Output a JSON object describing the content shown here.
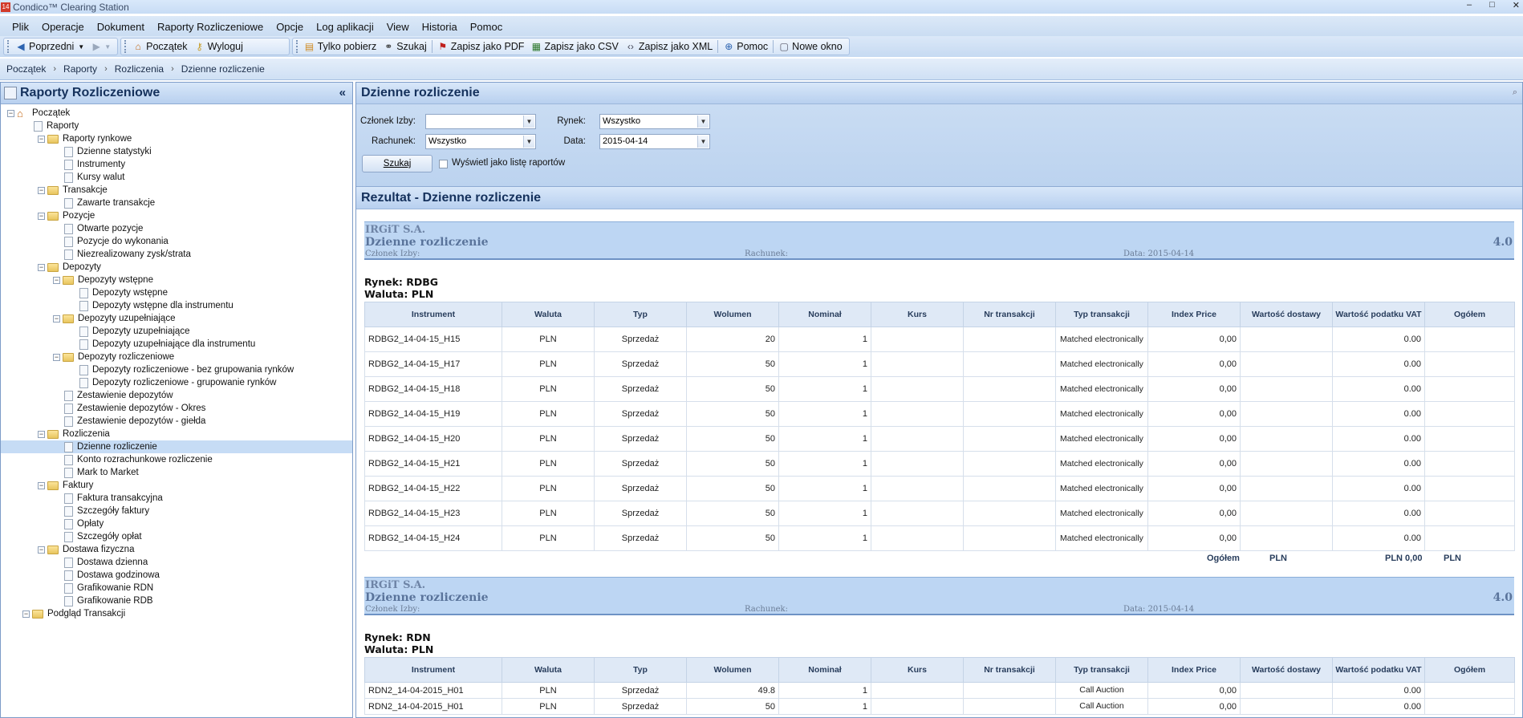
{
  "window": {
    "title": "Condico™ Clearing Station",
    "app_icon": "14",
    "controls": [
      "–",
      "□",
      "✕"
    ]
  },
  "menu": [
    "Plik",
    "Operacje",
    "Dokument",
    "Raporty Rozliczeniowe",
    "Opcje",
    "Log aplikacji",
    "View",
    "Historia",
    "Pomoc"
  ],
  "toolbar": {
    "prev": "Poprzedni",
    "home": "Początek",
    "logout": "Wyloguj",
    "fetch_only": "Tylko pobierz",
    "search": "Szukaj",
    "save_pdf": "Zapisz jako PDF",
    "save_csv": "Zapisz jako CSV",
    "save_xml": "Zapisz jako XML",
    "help": "Pomoc",
    "new_window": "Nowe okno"
  },
  "breadcrumb": [
    "Początek",
    "Raporty",
    "Rozliczenia",
    "Dzienne rozliczenie"
  ],
  "left_panel": {
    "title": "Raporty Rozliczeniowe",
    "collapse": "«",
    "tree": [
      {
        "label": "Początek",
        "level": 0,
        "kind": "home"
      },
      {
        "label": "Raporty",
        "level": 1,
        "kind": "doc"
      },
      {
        "label": "Raporty rynkowe",
        "level": 2,
        "kind": "folder"
      },
      {
        "label": "Dzienne statystyki",
        "level": 3,
        "kind": "doc"
      },
      {
        "label": "Instrumenty",
        "level": 3,
        "kind": "doc"
      },
      {
        "label": "Kursy walut",
        "level": 3,
        "kind": "doc"
      },
      {
        "label": "Transakcje",
        "level": 2,
        "kind": "folder"
      },
      {
        "label": "Zawarte transakcje",
        "level": 3,
        "kind": "doc"
      },
      {
        "label": "Pozycje",
        "level": 2,
        "kind": "folder"
      },
      {
        "label": "Otwarte pozycje",
        "level": 3,
        "kind": "doc"
      },
      {
        "label": "Pozycje do wykonania",
        "level": 3,
        "kind": "doc"
      },
      {
        "label": "Niezrealizowany zysk/strata",
        "level": 3,
        "kind": "doc"
      },
      {
        "label": "Depozyty",
        "level": 2,
        "kind": "folder"
      },
      {
        "label": "Depozyty wstępne",
        "level": 3,
        "kind": "folder"
      },
      {
        "label": "Depozyty wstępne",
        "level": 4,
        "kind": "doc"
      },
      {
        "label": "Depozyty wstępne dla instrumentu",
        "level": 4,
        "kind": "doc"
      },
      {
        "label": "Depozyty uzupełniające",
        "level": 3,
        "kind": "folder"
      },
      {
        "label": "Depozyty uzupełniające",
        "level": 4,
        "kind": "doc"
      },
      {
        "label": "Depozyty uzupełniające dla instrumentu",
        "level": 4,
        "kind": "doc"
      },
      {
        "label": "Depozyty rozliczeniowe",
        "level": 3,
        "kind": "folder"
      },
      {
        "label": "Depozyty rozliczeniowe - bez grupowania rynków",
        "level": 4,
        "kind": "doc"
      },
      {
        "label": "Depozyty rozliczeniowe - grupowanie rynków",
        "level": 4,
        "kind": "doc"
      },
      {
        "label": "Zestawienie depozytów",
        "level": 3,
        "kind": "doc"
      },
      {
        "label": "Zestawienie depozytów - Okres",
        "level": 3,
        "kind": "doc"
      },
      {
        "label": "Zestawienie depozytów - giełda",
        "level": 3,
        "kind": "doc"
      },
      {
        "label": "Rozliczenia",
        "level": 2,
        "kind": "folder"
      },
      {
        "label": "Dzienne rozliczenie",
        "level": 3,
        "kind": "doc",
        "selected": true
      },
      {
        "label": "Konto rozrachunkowe rozliczenie",
        "level": 3,
        "kind": "doc"
      },
      {
        "label": "Mark to Market",
        "level": 3,
        "kind": "doc"
      },
      {
        "label": "Faktury",
        "level": 2,
        "kind": "folder"
      },
      {
        "label": "Faktura transakcyjna",
        "level": 3,
        "kind": "doc"
      },
      {
        "label": "Szczegóły faktury",
        "level": 3,
        "kind": "doc"
      },
      {
        "label": "Opłaty",
        "level": 3,
        "kind": "doc"
      },
      {
        "label": "Szczegóły opłat",
        "level": 3,
        "kind": "doc"
      },
      {
        "label": "Dostawa fizyczna",
        "level": 2,
        "kind": "folder"
      },
      {
        "label": "Dostawa dzienna",
        "level": 3,
        "kind": "doc"
      },
      {
        "label": "Dostawa godzinowa",
        "level": 3,
        "kind": "doc"
      },
      {
        "label": "Grafikowanie RDN",
        "level": 3,
        "kind": "doc"
      },
      {
        "label": "Grafikowanie RDB",
        "level": 3,
        "kind": "doc"
      },
      {
        "label": "Podgląd Transakcji",
        "level": 1,
        "kind": "folder"
      }
    ]
  },
  "form": {
    "title": "Dzienne rozliczenie",
    "member_label": "Członek Izby:",
    "member_value": "",
    "market_label": "Rynek:",
    "market_value": "Wszystko",
    "account_label": "Rachunek:",
    "account_value": "Wszystko",
    "date_label": "Data:",
    "date_value": "2015-04-14",
    "search_button": "Szukaj",
    "list_checkbox": "Wyświetl jako listę raportów"
  },
  "results": {
    "title": "Rezultat - Dzienne rozliczenie",
    "columns": [
      "Instrument",
      "Waluta",
      "Typ",
      "Wolumen",
      "Nominał",
      "Kurs",
      "Nr transakcji",
      "Typ transakcji",
      "Index Price",
      "Wartość dostawy",
      "Wartość podatku VAT",
      "Ogółem"
    ],
    "reports": [
      {
        "company": "IRGiT S.A.",
        "report_title": "Dzienne rozliczenie",
        "version": "4.0",
        "member_label": "Członek Izby:",
        "account_label": "Rachunek:",
        "date_label": "Data: 2015-04-14",
        "market": "Rynek: RDBG",
        "currency": "Waluta: PLN",
        "rows": [
          [
            "RDBG2_14-04-15_H15",
            "PLN",
            "Sprzedaż",
            "20",
            "1",
            "",
            "",
            "Matched electronically",
            "0,00",
            "",
            "0.00",
            ""
          ],
          [
            "RDBG2_14-04-15_H17",
            "PLN",
            "Sprzedaż",
            "50",
            "1",
            "",
            "",
            "Matched electronically",
            "0,00",
            "",
            "0.00",
            ""
          ],
          [
            "RDBG2_14-04-15_H18",
            "PLN",
            "Sprzedaż",
            "50",
            "1",
            "",
            "",
            "Matched electronically",
            "0,00",
            "",
            "0.00",
            ""
          ],
          [
            "RDBG2_14-04-15_H19",
            "PLN",
            "Sprzedaż",
            "50",
            "1",
            "",
            "",
            "Matched electronically",
            "0,00",
            "",
            "0.00",
            ""
          ],
          [
            "RDBG2_14-04-15_H20",
            "PLN",
            "Sprzedaż",
            "50",
            "1",
            "",
            "",
            "Matched electronically",
            "0,00",
            "",
            "0.00",
            ""
          ],
          [
            "RDBG2_14-04-15_H21",
            "PLN",
            "Sprzedaż",
            "50",
            "1",
            "",
            "",
            "Matched electronically",
            "0,00",
            "",
            "0.00",
            ""
          ],
          [
            "RDBG2_14-04-15_H22",
            "PLN",
            "Sprzedaż",
            "50",
            "1",
            "",
            "",
            "Matched electronically",
            "0,00",
            "",
            "0.00",
            ""
          ],
          [
            "RDBG2_14-04-15_H23",
            "PLN",
            "Sprzedaż",
            "50",
            "1",
            "",
            "",
            "Matched electronically",
            "0,00",
            "",
            "0.00",
            ""
          ],
          [
            "RDBG2_14-04-15_H24",
            "PLN",
            "Sprzedaż",
            "50",
            "1",
            "",
            "",
            "Matched electronically",
            "0,00",
            "",
            "0.00",
            ""
          ]
        ],
        "totals": {
          "label": "Ogółem",
          "delivery": "PLN",
          "vat": "PLN 0,00",
          "total": "PLN"
        }
      },
      {
        "company": "IRGiT S.A.",
        "report_title": "Dzienne rozliczenie",
        "version": "4.0",
        "member_label": "Członek Izby:",
        "account_label": "Rachunek:",
        "date_label": "Data: 2015-04-14",
        "market": "Rynek: RDN",
        "currency": "Waluta: PLN",
        "rows": [
          [
            "RDN2_14-04-2015_H01",
            "PLN",
            "Sprzedaż",
            "49.8",
            "1",
            "",
            "",
            "Call Auction",
            "0,00",
            "",
            "0.00",
            ""
          ],
          [
            "RDN2_14-04-2015_H01",
            "PLN",
            "Sprzedaż",
            "50",
            "1",
            "",
            "",
            "Call Auction",
            "0,00",
            "",
            "0.00",
            ""
          ]
        ]
      }
    ]
  }
}
